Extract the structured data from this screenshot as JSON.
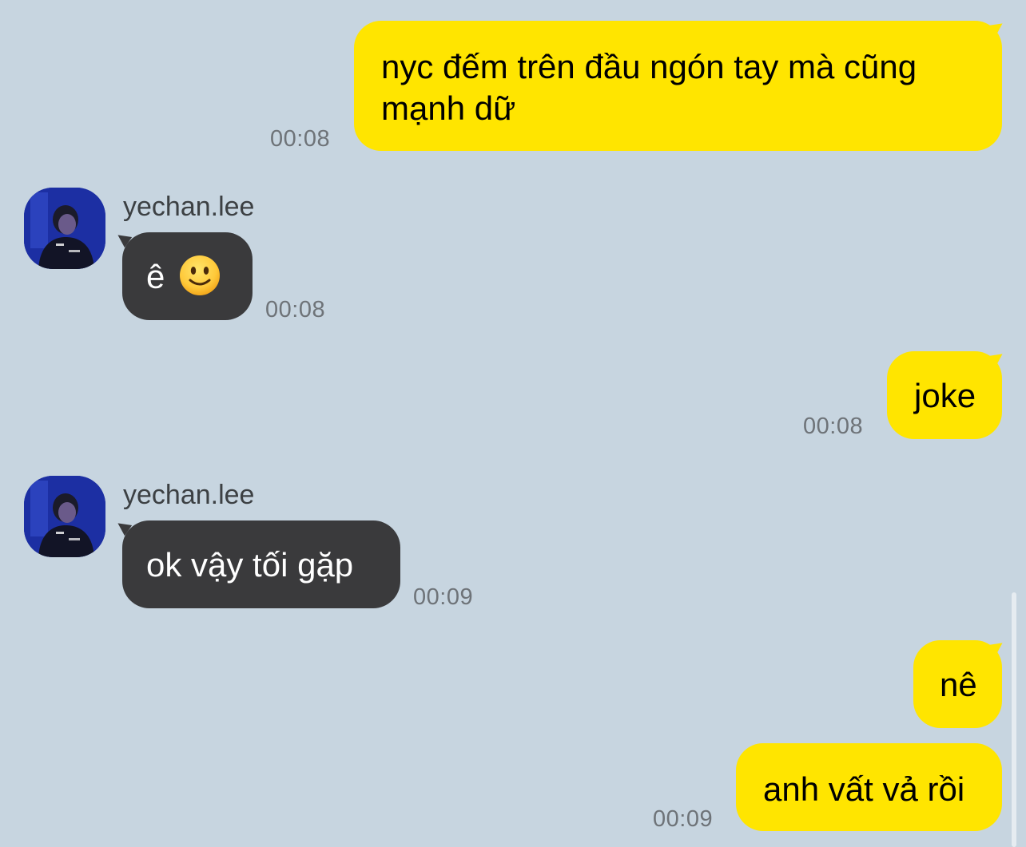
{
  "colors": {
    "background": "#c7d5e0",
    "outgoing_bubble": "#ffe500",
    "incoming_bubble": "#3a3a3c",
    "timestamp": "#6e7378"
  },
  "messages": [
    {
      "direction": "out",
      "lines": [
        "nyc đếm trên đầu ngón tay mà cũng",
        "mạnh dữ"
      ],
      "time": "00:08"
    },
    {
      "direction": "in",
      "sender": "yechan.lee",
      "text": "ê",
      "emoji": "slightly-smiling-face-icon",
      "time": "00:08"
    },
    {
      "direction": "out",
      "text": "joke",
      "time": "00:08"
    },
    {
      "direction": "in",
      "sender": "yechan.lee",
      "text": "ok vậy tối gặp",
      "time": "00:09"
    },
    {
      "direction": "out",
      "text": "nê",
      "time": ""
    },
    {
      "direction": "out",
      "text": "anh vất vả rồi",
      "time": "00:09"
    }
  ]
}
